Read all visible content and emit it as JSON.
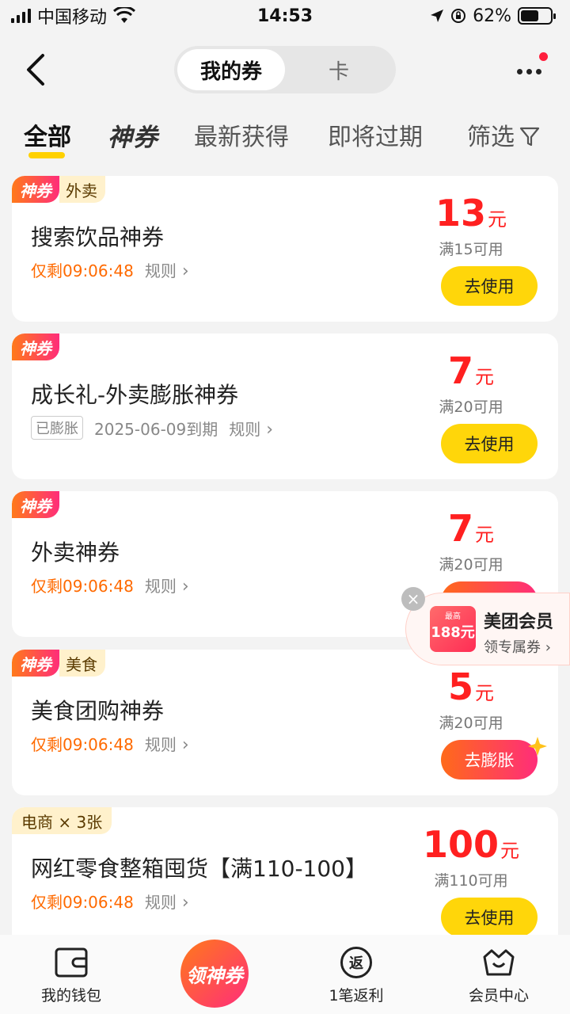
{
  "status": {
    "carrier": "中国移动",
    "time": "14:53",
    "battery": "62%",
    "battery_level": 0.62
  },
  "nav": {
    "seg_active": "我的券",
    "seg_other": "卡"
  },
  "tabs": {
    "all": "全部",
    "shen": "神券",
    "newest": "最新获得",
    "expiring": "即将过期",
    "filter": "筛选"
  },
  "coupons": [
    {
      "badge": "神券",
      "category": "外卖",
      "title": "搜索饮品神券",
      "countdown": "仅剩09:06:48",
      "rule": "规则",
      "amount": "13",
      "unit": "元",
      "condition": "满15可用",
      "button": "去使用"
    },
    {
      "badge": "神券",
      "title": "成长礼-外卖膨胀神券",
      "tag": "已膨胀",
      "expire": "2025-06-09到期",
      "rule": "规则",
      "amount": "7",
      "unit": "元",
      "condition": "满20可用",
      "button": "去使用"
    },
    {
      "badge": "神券",
      "title": "外卖神券",
      "countdown": "仅剩09:06:48",
      "rule": "规则",
      "amount": "7",
      "unit": "元",
      "condition": "满20可用"
    },
    {
      "badge": "神券",
      "category": "美食",
      "title": "美食团购神券",
      "countdown": "仅剩09:06:48",
      "rule": "规则",
      "amount": "5",
      "unit": "元",
      "condition": "满20可用",
      "button": "去膨胀"
    },
    {
      "category": "电商 × 3张",
      "title": "网红零食整箱囤货【满110-100】",
      "countdown": "仅剩09:06:48",
      "rule": "规则",
      "amount": "100",
      "unit": "元",
      "condition": "满110可用",
      "button": "去使用"
    }
  ],
  "float_ad": {
    "ticket_small": "最高",
    "ticket_amount": "188元",
    "title": "美团会员",
    "subtitle": "领专属券 ›",
    "close": "×"
  },
  "bottom": {
    "wallet": "我的钱包",
    "center": "领神券",
    "cashback": "1笔返利",
    "cashback_icon": "返",
    "member": "会员中心"
  }
}
